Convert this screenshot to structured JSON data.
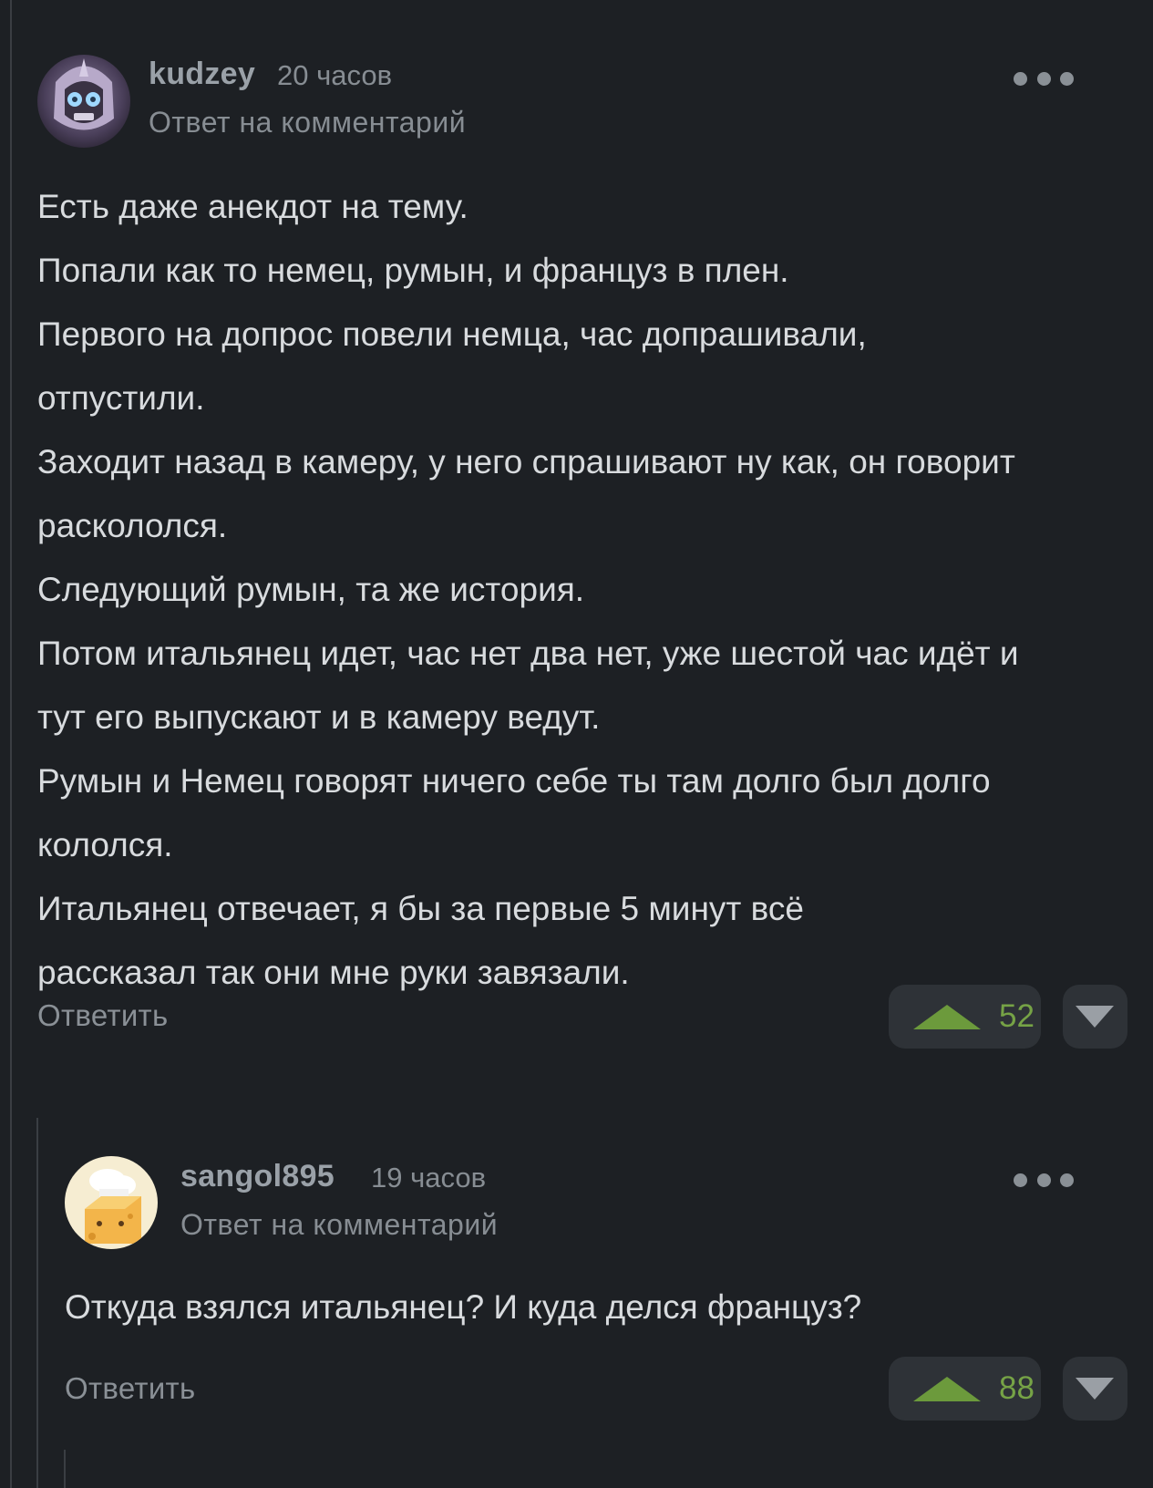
{
  "comments": [
    {
      "author": "kudzey",
      "time": "20 часов",
      "reply_label": "Ответ на комментарий",
      "avatar_icon": "skull-knight-avatar",
      "paragraphs": [
        "Есть даже анекдот на тему.",
        "Попали как то немец, румын, и француз в плен.",
        "Первого на допрос повели немца, час допрашивали, отпустили.",
        "Заходит назад в камеру, у него спрашивают ну как, он говорит раскололся.",
        "Следующий румын, та же история.",
        "Потом итальянец идет, час нет два нет, уже шестой час идёт и тут его выпускают и в камеру ведут.",
        "Румын и Немец говорят ничего себе ты там долго был долго кололся.",
        "Итальянец отвечает, я бы за первые 5 минут всё рассказал так они мне руки завязали."
      ],
      "reply_button": "Ответить",
      "rating": "52"
    },
    {
      "author": "sangol895",
      "time": "19 часов",
      "reply_label": "Ответ на комментарий",
      "avatar_icon": "cheese-chef-avatar",
      "paragraphs": [
        "Откуда взялся итальянец? И куда делся француз?"
      ],
      "reply_button": "Ответить",
      "rating": "88"
    }
  ],
  "colors": {
    "background": "#1d2024",
    "upvote": "#76a346",
    "button_bg": "#2e3237"
  }
}
